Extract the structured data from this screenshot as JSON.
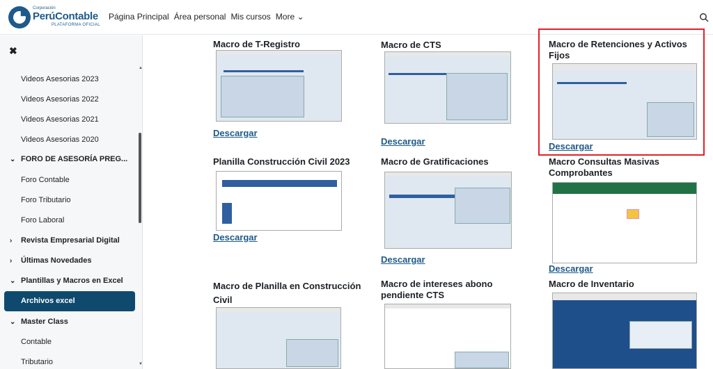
{
  "header": {
    "logo_small": "Corporación",
    "logo_main": "PerúContable",
    "logo_sub": "PLATAFORMA OFICIAL",
    "nav": [
      "Página Principal",
      "Área personal",
      "Mis cursos",
      "More ⌄"
    ]
  },
  "drawer": {
    "items": [
      {
        "label": "Videos Asesorias 2023",
        "type": "item"
      },
      {
        "label": "Videos Asesorias 2022",
        "type": "item"
      },
      {
        "label": "Videos Asesorias 2021",
        "type": "item"
      },
      {
        "label": "Videos Asesorias 2020",
        "type": "item"
      },
      {
        "label": "FORO DE ASESORÍA PREG...",
        "type": "section-open"
      },
      {
        "label": "Foro Contable",
        "type": "item"
      },
      {
        "label": "Foro Tributario",
        "type": "item"
      },
      {
        "label": "Foro Laboral",
        "type": "item"
      },
      {
        "label": "Revista Empresarial Digital",
        "type": "section-closed"
      },
      {
        "label": "Últimas Novedades",
        "type": "section-closed"
      },
      {
        "label": "Plantillas y Macros en Excel",
        "type": "section-open"
      },
      {
        "label": "Archivos excel",
        "type": "active"
      },
      {
        "label": "Master Class",
        "type": "section-open"
      },
      {
        "label": "Contable",
        "type": "item"
      },
      {
        "label": "Tributario",
        "type": "item"
      }
    ]
  },
  "main": {
    "cards": [
      {
        "title": "Macro de T-Registro",
        "download": "Descargar"
      },
      {
        "title": "Macro de CTS",
        "download": "Descargar"
      },
      {
        "title": "Macro de Retenciones y Activos Fijos",
        "download": "Descargar"
      },
      {
        "title": "Planilla Construcción Civil 2023",
        "download": "Descargar"
      },
      {
        "title": "Macro de Gratificaciones",
        "download": "Descargar"
      },
      {
        "title": "Macro Consultas Masivas Comprobantes",
        "download": "Descargar"
      },
      {
        "title": "Macro de Planilla en Construcción Civil",
        "download": ""
      },
      {
        "title": "Macro de intereses abono pendiente CTS",
        "download": ""
      },
      {
        "title": "Macro de Inventario",
        "download": ""
      }
    ]
  },
  "colors": {
    "accent": "#1e5a8a",
    "active": "#0f4a6e",
    "highlight": "#e0202a"
  }
}
